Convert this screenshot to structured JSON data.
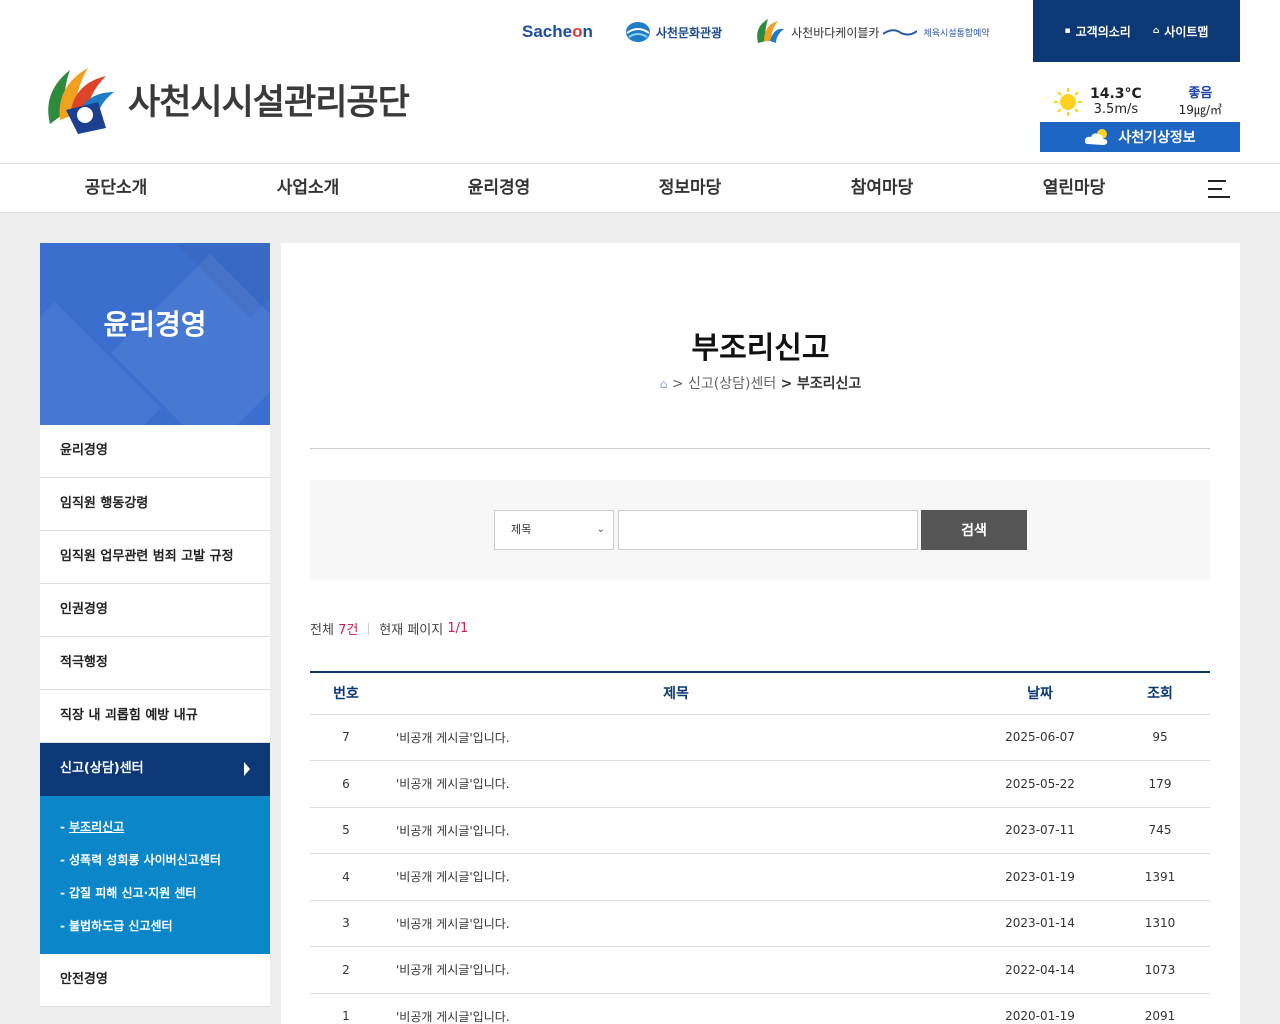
{
  "header": {
    "logo_text": "사천시시설관리공단",
    "partners": {
      "sacheon_prefix": "Sache",
      "sacheon_o": "o",
      "sacheon_suffix": "n",
      "culture": "사천문화관광",
      "cable": "사천바다케이블카",
      "sports": "체육시설통합예약"
    },
    "utility": {
      "voice": "고객의소리",
      "sitemap": "사이트맵"
    },
    "weather": {
      "temp": "14.3°C",
      "wind": "3.5m/s",
      "air_status": "좋음",
      "air_value": "19㎍/㎥",
      "button": "사천기상정보"
    }
  },
  "gnb": [
    "공단소개",
    "사업소개",
    "윤리경영",
    "정보마당",
    "참여마당",
    "열린마당"
  ],
  "sidebar": {
    "title": "윤리경영",
    "items_before": [
      "윤리경영",
      "임직원 행동강령",
      "임직원 업무관련 범죄 고발 규정",
      "인권경영",
      "적극행정",
      "직장 내 괴롭힘 예방 내규"
    ],
    "active": "신고(상담)센터",
    "sub": [
      "부조리신고",
      "성폭력 성희롱 사이버신고센터",
      "갑질 피해 신고·지원 센터",
      "불법하도급 신고센터"
    ],
    "items_after": [
      "안전경영"
    ]
  },
  "main": {
    "title": "부조리신고",
    "breadcrumb": {
      "sep": ">",
      "parent": "신고(상담)센터",
      "current": "부조리신고"
    },
    "search": {
      "select_value": "제목",
      "input_value": "",
      "button": "검색"
    },
    "info": {
      "total_label": "전체",
      "total_count": "7건",
      "page_label": "현재 페이지",
      "page_value": "1/1"
    },
    "table": {
      "headers": [
        "번호",
        "제목",
        "날짜",
        "조회"
      ],
      "rows": [
        [
          "7",
          "'비공개 게시글'입니다.",
          "2025-06-07",
          "95"
        ],
        [
          "6",
          "'비공개 게시글'입니다.",
          "2025-05-22",
          "179"
        ],
        [
          "5",
          "'비공개 게시글'입니다.",
          "2023-07-11",
          "745"
        ],
        [
          "4",
          "'비공개 게시글'입니다.",
          "2023-01-19",
          "1391"
        ],
        [
          "3",
          "'비공개 게시글'입니다.",
          "2023-01-14",
          "1310"
        ],
        [
          "2",
          "'비공개 게시글'입니다.",
          "2022-04-14",
          "1073"
        ],
        [
          "1",
          "'비공개 게시글'입니다.",
          "2020-01-19",
          "2091"
        ]
      ]
    }
  },
  "colors": {
    "navy": "#0d3876",
    "sub_blue": "#0a86c9",
    "side_head": "#3b6fcf",
    "accent_red": "#d11d4d"
  }
}
